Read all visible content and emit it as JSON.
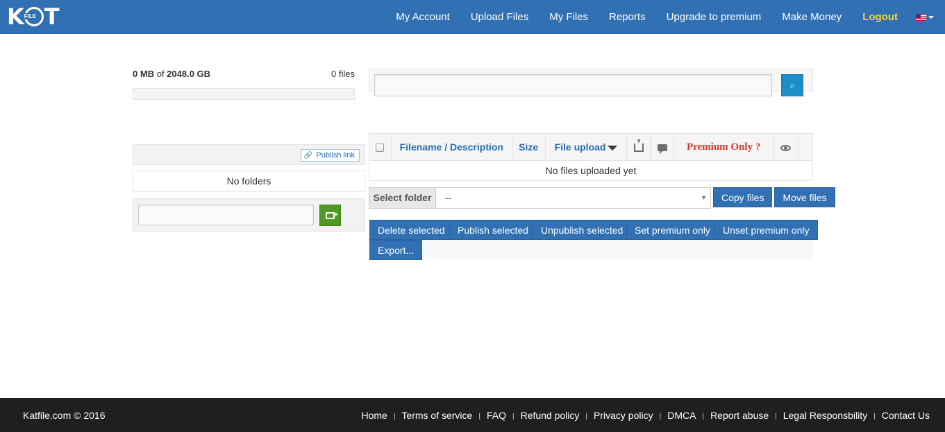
{
  "header": {
    "logo_text": "KAT FILE",
    "nav": [
      "My Account",
      "Upload Files",
      "My Files",
      "Reports",
      "Upgrade to premium",
      "Make Money"
    ],
    "logout": "Logout",
    "language_icon": "us-flag-icon"
  },
  "storage": {
    "used": "0 MB",
    "of": "of",
    "total": "2048.0 GB",
    "files_count": "0 files",
    "used_fraction": 0
  },
  "folders": {
    "publish_link": "Publish link",
    "empty_text": "No folders",
    "new_folder_value": ""
  },
  "search": {
    "value": ""
  },
  "table": {
    "headers": {
      "filename": "Filename / Description",
      "size": "Size",
      "upload": "File upload",
      "premium": "Premium Only ?"
    },
    "empty_text": "No files uploaded yet"
  },
  "move": {
    "select_label": "Select folder",
    "selected": "--",
    "copy_button": "Copy files",
    "move_button": "Move files"
  },
  "actions": {
    "delete": "Delete selected",
    "publish": "Publish selected",
    "unpublish": "Unpublish selected",
    "set_premium": "Set premium only",
    "unset_premium": "Unset premium only",
    "export": "Export..."
  },
  "footer": {
    "copyright": "Katfile.com © 2016",
    "links": [
      "Home",
      "Terms of service",
      "FAQ",
      "Refund policy",
      "Privacy policy",
      "DMCA",
      "Report abuse",
      "Legal Responsbility",
      "Contact Us"
    ],
    "separator": "|"
  },
  "colors": {
    "header_bg": "#3070b3",
    "logout": "#f7d430",
    "premium_text": "#d03a2a",
    "footer_bg": "#1f1f1f",
    "create_folder_button": "#4e9a22",
    "search_button": "#1d8fc7"
  }
}
